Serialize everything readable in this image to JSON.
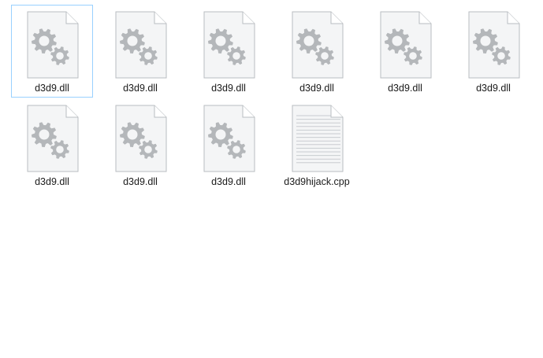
{
  "folder": {
    "items": [
      {
        "name": "d3d9.dll",
        "type": "dll",
        "icon": "settings-file-icon",
        "selected": true
      },
      {
        "name": "d3d9.dll",
        "type": "dll",
        "icon": "settings-file-icon",
        "selected": false
      },
      {
        "name": "d3d9.dll",
        "type": "dll",
        "icon": "settings-file-icon",
        "selected": false
      },
      {
        "name": "d3d9.dll",
        "type": "dll",
        "icon": "settings-file-icon",
        "selected": false
      },
      {
        "name": "d3d9.dll",
        "type": "dll",
        "icon": "settings-file-icon",
        "selected": false
      },
      {
        "name": "d3d9.dll",
        "type": "dll",
        "icon": "settings-file-icon",
        "selected": false
      },
      {
        "name": "d3d9.dll",
        "type": "dll",
        "icon": "settings-file-icon",
        "selected": false
      },
      {
        "name": "d3d9.dll",
        "type": "dll",
        "icon": "settings-file-icon",
        "selected": false
      },
      {
        "name": "d3d9.dll",
        "type": "dll",
        "icon": "settings-file-icon",
        "selected": false
      },
      {
        "name": "d3d9hijack.cpp",
        "type": "cpp",
        "icon": "text-file-icon",
        "selected": false
      }
    ]
  },
  "colors": {
    "selection_border": "#99d1ff",
    "page_fill": "#f4f5f6",
    "page_border": "#b9bdc1",
    "gear_fill": "#b4b7ba",
    "text_line": "#c9ccd0"
  }
}
